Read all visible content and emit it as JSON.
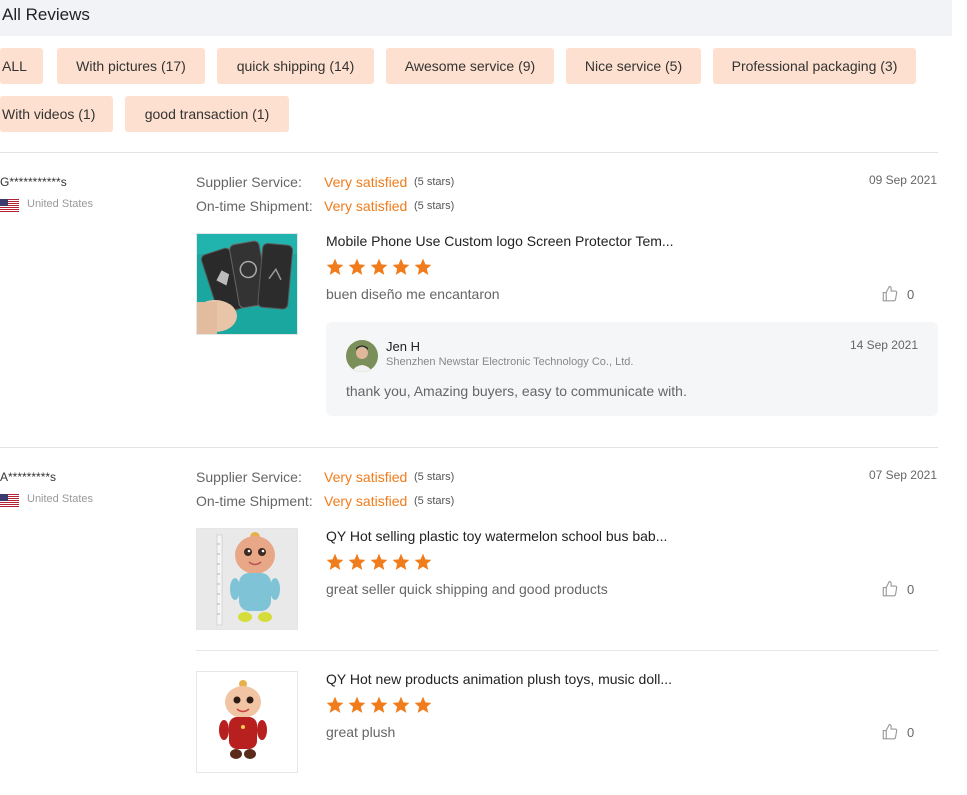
{
  "header": {
    "title": "All Reviews"
  },
  "filters": [
    {
      "label": "ALL"
    },
    {
      "label": "With pictures (17)"
    },
    {
      "label": "quick shipping (14)"
    },
    {
      "label": "Awesome service (9)"
    },
    {
      "label": "Nice service (5)"
    },
    {
      "label": "Professional packaging (3)"
    },
    {
      "label": "With videos (1)"
    },
    {
      "label": "good transaction (1)"
    }
  ],
  "colors": {
    "accent": "#f07c1b",
    "tag_bg": "#fde0cf",
    "header_bg": "#f2f3f7"
  },
  "reviews": [
    {
      "reviewer": "G***********s",
      "country": "United States",
      "date": "09 Sep 2021",
      "supplier_service_label": "Supplier Service:",
      "supplier_service_value": "Very satisfied",
      "supplier_service_stars": "(5 stars)",
      "shipment_label": "On-time Shipment:",
      "shipment_value": "Very satisfied",
      "shipment_stars": "(5 stars)",
      "products": [
        {
          "title": "Mobile Phone Use Custom logo Screen Protector Tem...",
          "rating": 5,
          "comment": "buen diseño me encantaron",
          "likes": "0"
        }
      ],
      "reply": {
        "name": "Jen H",
        "company": "Shenzhen Newstar Electronic Technology Co., Ltd.",
        "date": "14 Sep 2021",
        "text": "thank you, Amazing buyers, easy to communicate with."
      }
    },
    {
      "reviewer": "A*********s",
      "country": "United States",
      "date": "07 Sep 2021",
      "supplier_service_label": "Supplier Service:",
      "supplier_service_value": "Very satisfied",
      "supplier_service_stars": "(5 stars)",
      "shipment_label": "On-time Shipment:",
      "shipment_value": "Very satisfied",
      "shipment_stars": "(5 stars)",
      "products": [
        {
          "title": "QY Hot selling plastic toy watermelon school bus bab...",
          "rating": 5,
          "comment": "great seller quick shipping and good products",
          "likes": "0"
        },
        {
          "title": "QY Hot new products animation plush toys, music doll...",
          "rating": 5,
          "comment": "great plush",
          "likes": "0"
        }
      ]
    }
  ]
}
